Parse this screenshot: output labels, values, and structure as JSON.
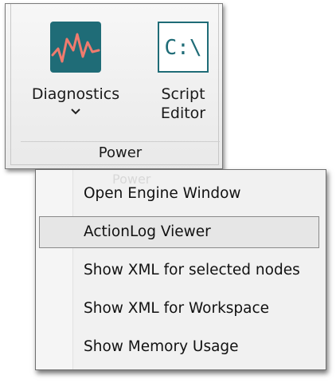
{
  "ribbon": {
    "group_label": "Power",
    "buttons": [
      {
        "label": "Diagnostics",
        "icon": "pulse-chart-icon",
        "has_dropdown": true
      },
      {
        "label_line1": "Script",
        "label_line2": "Editor",
        "icon": "command-prompt-icon",
        "icon_text": "C:\\"
      }
    ]
  },
  "menu": {
    "ghost_text": "Power",
    "items": [
      {
        "label": "Open Engine Window",
        "selected": false
      },
      {
        "label": "ActionLog Viewer",
        "selected": true
      },
      {
        "label": "Show XML for selected nodes",
        "selected": false
      },
      {
        "label": "Show XML for Workspace",
        "selected": false
      },
      {
        "label": "Show Memory Usage",
        "selected": false
      }
    ]
  },
  "colors": {
    "icon_teal": "#1f6c77",
    "pulse_line": "#f07b6e",
    "selection_bg": "#e6e6e6",
    "selection_border": "#8a8a8a"
  }
}
